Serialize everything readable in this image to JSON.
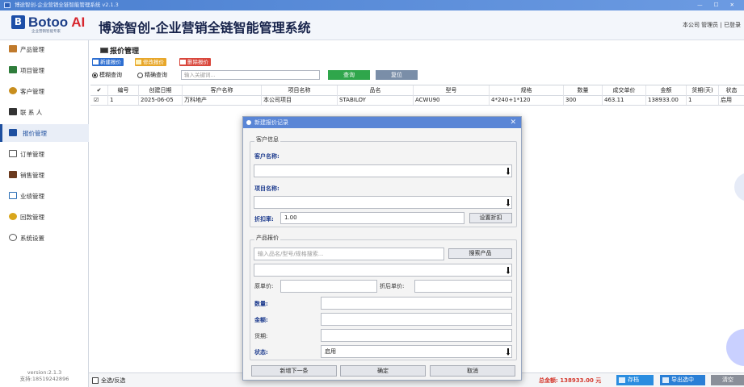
{
  "window": {
    "title": "博途智创-企业营销全链智能管理系统 v2.1.3",
    "controls": "— ☐ ✕"
  },
  "header": {
    "logo_text": "Botoo",
    "logo_ai": "AI",
    "logo_letter": "B",
    "logo_sub": "企业营销智能专家",
    "app_title": "博途智创-企业营销全链智能管理系统",
    "user": "本公司  管理员 | 已登录"
  },
  "sidebar": {
    "items": [
      {
        "label": "产品管理",
        "icon": "product-icon",
        "color": "#c07a2c"
      },
      {
        "label": "项目管理",
        "icon": "project-icon",
        "color": "#2f7d3b"
      },
      {
        "label": "客户管理",
        "icon": "customer-icon",
        "color": "#c88e1e"
      },
      {
        "label": "联 系 人",
        "icon": "contacts-icon",
        "color": "#333333"
      },
      {
        "label": "报价管理",
        "icon": "quote-icon",
        "color": "#1e4f9f"
      },
      {
        "label": "订单管理",
        "icon": "order-icon",
        "color": "#555555"
      },
      {
        "label": "销售管理",
        "icon": "sales-icon",
        "color": "#6b3a1e"
      },
      {
        "label": "业绩管理",
        "icon": "performance-icon",
        "color": "#2a6db5"
      },
      {
        "label": "回款管理",
        "icon": "payment-icon",
        "color": "#d9a61c"
      },
      {
        "label": "系统设置",
        "icon": "settings-icon",
        "color": "#555555"
      }
    ],
    "version": "version:2.1.3",
    "support": "支持:18519242896"
  },
  "main": {
    "title": "报价管理",
    "toolbar": {
      "new": "新建报价",
      "edit": "修改报价",
      "delete": "删除报价"
    },
    "search": {
      "fuzzy": "模糊查询",
      "exact": "精确查询",
      "placeholder": "输入关键词...",
      "query": "查询",
      "reset": "复位"
    },
    "columns": [
      "✔",
      "编号",
      "创建日期",
      "客户名称",
      "项目名称",
      "品名",
      "型号",
      "规格",
      "数量",
      "成交单价",
      "金额",
      "货期(天)",
      "状态"
    ],
    "rows": [
      [
        "☑",
        "1",
        "2025-06-05",
        "万科地产",
        "本公司项目",
        "STABILOY",
        "ACWU90",
        "4*240+1*120",
        "300",
        "463.11",
        "138933.00",
        "1",
        "启用"
      ]
    ]
  },
  "bottom": {
    "select_all": "全选/反选",
    "total": "总金额: 138933.00 元",
    "save": "存档",
    "export": "导出选中",
    "clear": "清空"
  },
  "dialog": {
    "title": "新建报价记录",
    "customer_group": "客户信息",
    "customer_label": "客户名称:",
    "project_label": "项目名称:",
    "discount_label": "折扣率:",
    "discount_value": "1.00",
    "set_discount": "设置折扣",
    "product_group": "产品报价",
    "product_placeholder": "输入品名/型号/规格搜索...",
    "search_product": "搜索产品",
    "orig_price": "原单价:",
    "disc_price": "折后单价:",
    "qty": "数量:",
    "amount": "金额:",
    "delivery": "货期:",
    "status_label": "状态:",
    "status_value": "启用",
    "btn_next": "新增下一条",
    "btn_ok": "确定",
    "btn_cancel": "取消"
  },
  "colors": {
    "accent": "#1e4f9f",
    "query": "#2fa64b",
    "reset": "#7a8ea8",
    "new": "#2e6fd1",
    "edit": "#e8a72a",
    "delete": "#d9473c",
    "save": "#2a8de0",
    "export": "#2a7fd6",
    "clear": "#8a8f99"
  }
}
